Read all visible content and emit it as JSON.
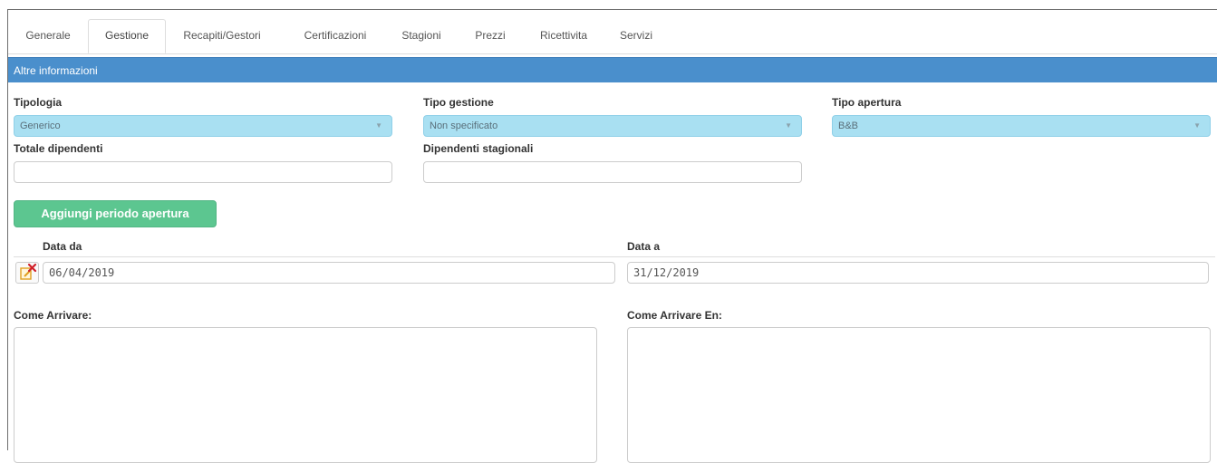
{
  "tabs": [
    "Generale",
    "Gestione",
    "Recapiti/Gestori",
    "Certificazioni",
    "Stagioni",
    "Prezzi",
    "Ricettivita",
    "Servizi"
  ],
  "active_tab": "Gestione",
  "section": {
    "title": "Altre informazioni"
  },
  "fields": {
    "tipologia": {
      "label": "Tipologia",
      "value": "Generico"
    },
    "tipo_gestione": {
      "label": "Tipo gestione",
      "value": "Non specificato"
    },
    "tipo_apertura": {
      "label": "Tipo apertura",
      "value": "B&B"
    },
    "totale_dipendenti": {
      "label": "Totale dipendenti",
      "value": ""
    },
    "dipendenti_stagionali": {
      "label": "Dipendenti stagionali",
      "value": ""
    }
  },
  "periodo": {
    "add_button_label": "Aggiungi periodo apertura",
    "col_from": "Data da",
    "col_to": "Data a",
    "rows": [
      {
        "from": "06/04/2019",
        "to": "31/12/2019"
      }
    ]
  },
  "come_arrivare": {
    "label": "Come Arrivare:",
    "value": ""
  },
  "come_arrivare_en": {
    "label": "Come Arrivare En:",
    "value": ""
  },
  "colors": {
    "header_bg": "#4a8fcc",
    "select_bg": "#a9e0f2",
    "add_button": "#5cc690"
  },
  "icons": {
    "dropdown": "caret-down-icon",
    "delete_row": "edit-delete-icon"
  }
}
